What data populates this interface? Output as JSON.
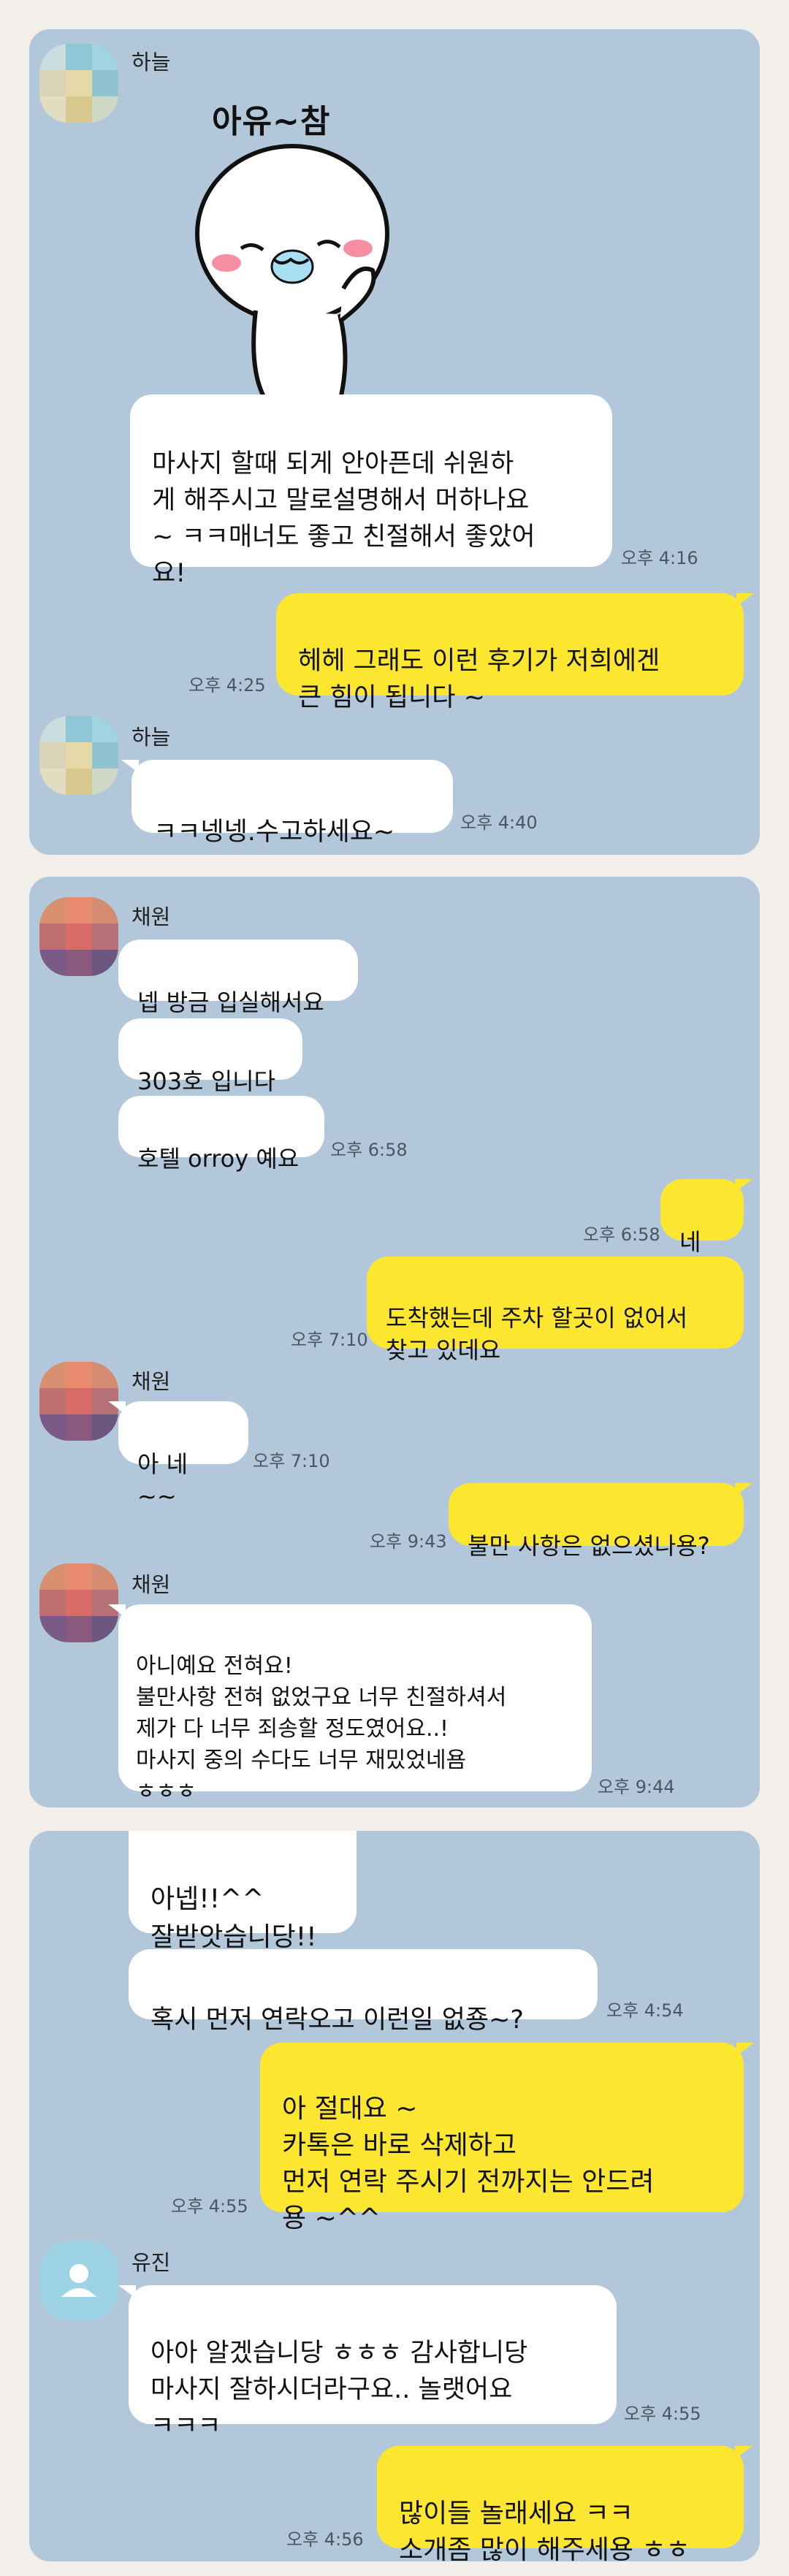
{
  "sections": [
    {
      "messages": [
        {
          "sender": "하늘"
        },
        {
          "sticker_caption": "아유~참"
        },
        {
          "text": "마사지 할때 되게 안아픈데 쉬원하\n게 해주시고 말로설명해서 머하나요\n~ ㅋㅋ매너도 좋고 친절해서 좋았어\n요!",
          "time": "오후 4:16"
        },
        {
          "text": "헤헤 그래도 이런 후기가 저희에겐\n큰 힘이 됩니다 ~",
          "time": "오후 4:25"
        },
        {
          "sender": "하늘"
        },
        {
          "text": "ㅋㅋ넹넹.수고하세요~",
          "time": "오후 4:40"
        }
      ]
    },
    {
      "messages": [
        {
          "sender": "채원"
        },
        {
          "text": "넵 방금 입실해서요"
        },
        {
          "text": "303호 입니다"
        },
        {
          "text": "호텔 orroy 예요",
          "time": "오후 6:58"
        },
        {
          "text": "네 ~",
          "time": "오후 6:58"
        },
        {
          "text": "도착했는데  주차 할곳이 없어서\n찾고 있데요",
          "time": "오후 7:10"
        },
        {
          "sender": "채원"
        },
        {
          "text": "아 네~~",
          "time": "오후 7:10"
        },
        {
          "text": "불만 사항은 없으셨나용?",
          "time": "오후 9:43"
        },
        {
          "sender": "채원"
        },
        {
          "text": "아니예요 전혀요!\n불만사항 전혀 없었구요 너무 친절하셔서\n제가 다 너무 죄송할 정도였어요..!\n마사지 중의 수다도 너무 재밌었네욤\nㅎㅎㅎ",
          "time": "오후 9:44"
        }
      ]
    },
    {
      "messages": [
        {
          "text": "아넵!!^^\n잘받앗습니당!!"
        },
        {
          "text": "혹시 먼저 연락오고 이런일 없죵~?",
          "time": "오후 4:54"
        },
        {
          "text": "아 절대요 ~\n카톡은 바로 삭제하고\n먼저 연락 주시기 전까지는 안드려\n용 ~^^",
          "time": "오후 4:55"
        },
        {
          "sender": "유진"
        },
        {
          "text": "아아 알겠습니당 ㅎㅎㅎ 감사합니당\n마사지 잘하시더라구요.. 놀랫어요\nㅋㅋㅋ",
          "time": "오후 4:55"
        },
        {
          "text": "많이들 놀래세요 ㅋㅋ\n소개좀 많이 해주세용 ㅎㅎ",
          "time": "오후 4:56"
        }
      ]
    }
  ],
  "colors": {
    "chat_bg": "#b2c7da",
    "page_bg": "#f2efea",
    "my_bubble": "#fde62f",
    "their_bubble": "#ffffff",
    "default_avatar": "#9ed3e6"
  }
}
